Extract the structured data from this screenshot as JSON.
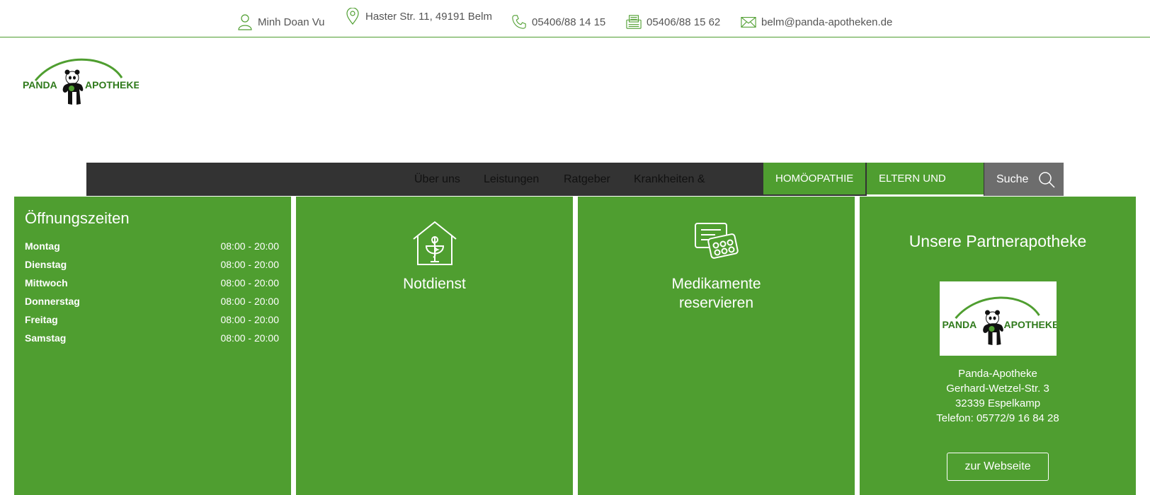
{
  "topbar": {
    "user": "Minh Doan Vu",
    "address": "Haster Str. 11, 49191 Belm",
    "phone": "05406/88 14 15",
    "fax": "05406/88 15 62",
    "email": "belm@panda-apotheken.de",
    "accent": "#4f9e30"
  },
  "logo": {
    "left_word": "PANDA",
    "right_word": "APOTHEKE"
  },
  "nav": {
    "items": [
      "Über uns",
      "Leistungen",
      "Ratgeber",
      "Krankheiten &"
    ],
    "homoeopathie": "HOMÖOPATHIE",
    "eltern": "ELTERN UND",
    "search": "Suche"
  },
  "hours": {
    "title": "Öffnungszeiten",
    "rows": [
      {
        "day": "Montag",
        "time": "08:00 - 20:00"
      },
      {
        "day": "Dienstag",
        "time": "08:00 - 20:00"
      },
      {
        "day": "Mittwoch",
        "time": "08:00 - 20:00"
      },
      {
        "day": "Donnerstag",
        "time": "08:00 - 20:00"
      },
      {
        "day": "Freitag",
        "time": "08:00 - 20:00"
      },
      {
        "day": "Samstag",
        "time": "08:00 - 20:00"
      }
    ]
  },
  "tiles": {
    "notdienst": "Notdienst",
    "medikamente_line1": "Medikamente",
    "medikamente_line2": "reservieren"
  },
  "partner": {
    "title": "Unsere Partnerapotheke",
    "name": "Panda-Apotheke",
    "street": "Gerhard-Wetzel-Str. 3",
    "city": "32339 Espelkamp",
    "phone": "Telefon: 05772/9 16 84 28",
    "button": "zur Webseite"
  }
}
